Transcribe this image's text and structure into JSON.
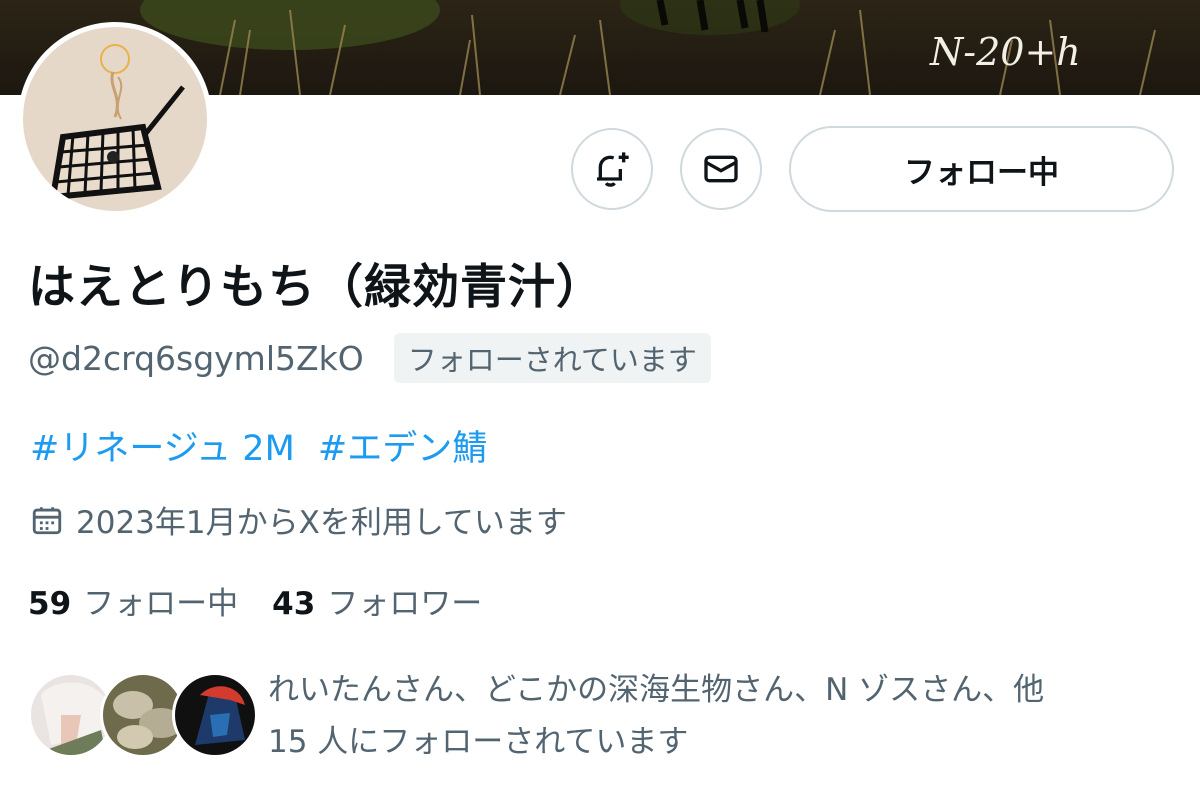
{
  "profile": {
    "display_name": "はえとりもち（緑効青汁）",
    "handle": "@d2crq6sgyml5ZkO",
    "follows_you_badge": "フォローされています",
    "bio_hashtags": [
      "#リネージュ 2M",
      "#エデン鯖"
    ],
    "joined": "2023年1月からXを利用しています",
    "banner_signature": "N-20+h"
  },
  "actions": {
    "notify_icon": "bell-plus-icon",
    "message_icon": "mail-icon",
    "follow_label": "フォロー中"
  },
  "stats": {
    "following_count": "59",
    "following_label": "フォロー中",
    "followers_count": "43",
    "followers_label": "フォロワー"
  },
  "known_followers": {
    "line1": "れいたんさん、どこかの深海生物さん、N ゾスさん、他",
    "line2": "15 人にフォローされています"
  },
  "colors": {
    "link": "#1d9bf0",
    "secondary_text": "#536471",
    "border": "#cfd9de",
    "badge_bg": "#eff3f4"
  }
}
